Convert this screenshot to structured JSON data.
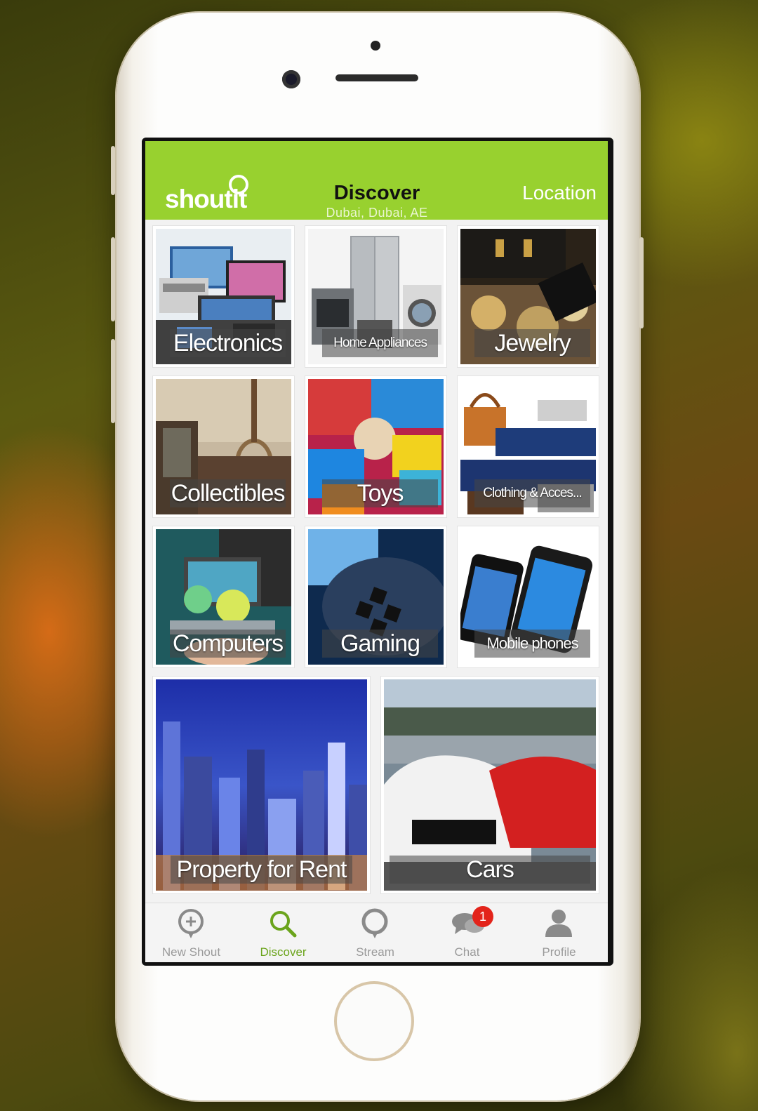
{
  "header": {
    "logo": "shoutit",
    "title": "Discover",
    "subtitle": "Dubai, Dubai, AE",
    "location_button": "Location"
  },
  "categories": [
    {
      "label": "Electronics"
    },
    {
      "label": "Home Appliances"
    },
    {
      "label": "Jewelry"
    },
    {
      "label": "Collectibles"
    },
    {
      "label": "Toys"
    },
    {
      "label": "Clothing & Acces..."
    },
    {
      "label": "Computers"
    },
    {
      "label": "Gaming"
    },
    {
      "label": "Mobile phones"
    },
    {
      "label": "Property for Rent"
    },
    {
      "label": "Cars"
    }
  ],
  "tabbar": {
    "items": [
      {
        "label": "New Shout",
        "icon": "new-shout-icon"
      },
      {
        "label": "Discover",
        "icon": "search-icon"
      },
      {
        "label": "Stream",
        "icon": "stream-icon"
      },
      {
        "label": "Chat",
        "icon": "chat-icon",
        "badge": "1"
      },
      {
        "label": "Profile",
        "icon": "profile-icon"
      }
    ],
    "active": "Discover"
  },
  "colors": {
    "brand_green": "#98d12f",
    "active_tab": "#6ba41c",
    "badge_red": "#e3241b"
  }
}
